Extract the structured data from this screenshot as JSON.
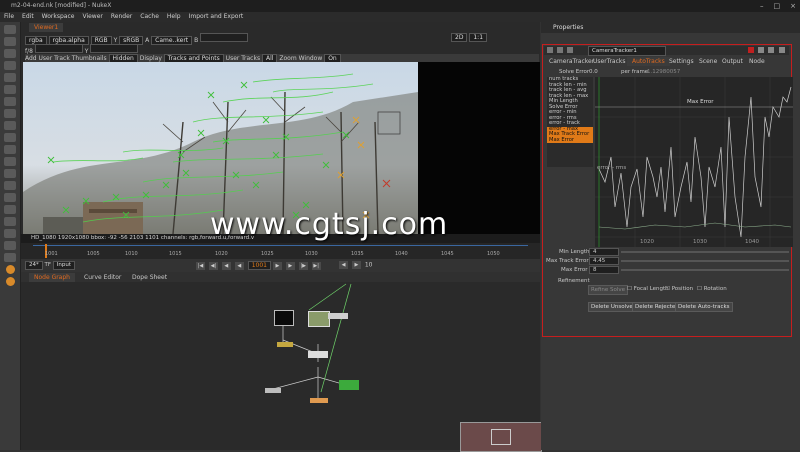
{
  "titlebar": {
    "title": "m2-04-end.nk [modified] - NukeX",
    "minimize": "–",
    "maximize": "□",
    "close": "×"
  },
  "menubar": [
    "File",
    "Edit",
    "Workspace",
    "Viewer",
    "Render",
    "Cache",
    "Help",
    "Import and Export"
  ],
  "viewer": {
    "tab": "Viewer1",
    "row1": {
      "channels": "rgba",
      "channel2": "rgba.alpha",
      "colorspace": "RGB",
      "y": "Y",
      "lut": "sRGB",
      "input_a": "A",
      "input_a_name": "Came..kert",
      "input_b": "B",
      "zoom": "2D",
      "zoom_pct": "1:1",
      "gain": "f/8",
      "gamma": "Y"
    },
    "row2": {
      "add_track": "Add User Track",
      "thumbnails_label": "Thumbnails",
      "thumbnails": "Hidden",
      "display_label": "Display",
      "display": "Tracks and Points",
      "user_tracks_label": "User Tracks",
      "user_tracks": "All",
      "zoom_window_label": "Zoom Window",
      "zoom_window": "On"
    },
    "infobar": "HD_1080 1920x1080  bbox: -92 -56 2103 1101 channels: rgb,forward.u,forward.v",
    "ticks": [
      "1001",
      "1005",
      "1010",
      "1015",
      "1020",
      "1025",
      "1030",
      "1035",
      "1040",
      "1045",
      "1050"
    ],
    "transport": {
      "fps": "24*",
      "tf": "TF",
      "input": "Input",
      "frame": "1001",
      "step": "10"
    }
  },
  "nodegraph": {
    "tabs": [
      "Node Graph",
      "Curve Editor",
      "Dope Sheet"
    ]
  },
  "properties": {
    "title": "Properties",
    "node_name": "CameraTracker1",
    "tabs": [
      "CameraTracker",
      "UserTracks",
      "AutoTracks",
      "Settings",
      "Scene",
      "Output",
      "Node"
    ],
    "solve_error_label": "Solve Error",
    "solve_error": "0.0",
    "per_frame_label": "per frame",
    "per_frame": "1.12980057",
    "list": [
      "num tracks",
      "track len - min",
      "track len - avg",
      "track len - max",
      "Min Length",
      "Solve Error",
      "error - min",
      "error - rms",
      "error - track",
      "error - max",
      "Max Track Error",
      "Max Error"
    ],
    "curve_label_max": "Max Error",
    "curve_label_rms": "error - rms",
    "curve_axis": [
      "1020",
      "1030",
      "1040"
    ],
    "min_length_label": "Min Length",
    "min_length": "4",
    "max_track_error_label": "Max Track Error",
    "max_track_error": "4.45",
    "max_error_label": "Max Error",
    "max_error": "8",
    "refinement_label": "Refinement",
    "refine_btn": "Refine Solve",
    "focal_length": "Focal Length",
    "position": "Position",
    "rotation": "Rotation",
    "btn_delete_unsolved": "Delete Unsolved",
    "btn_delete_rejected": "Delete Rejected",
    "btn_delete_auto": "Delete Auto-tracks"
  },
  "watermark": "www.cgtsj.com"
}
